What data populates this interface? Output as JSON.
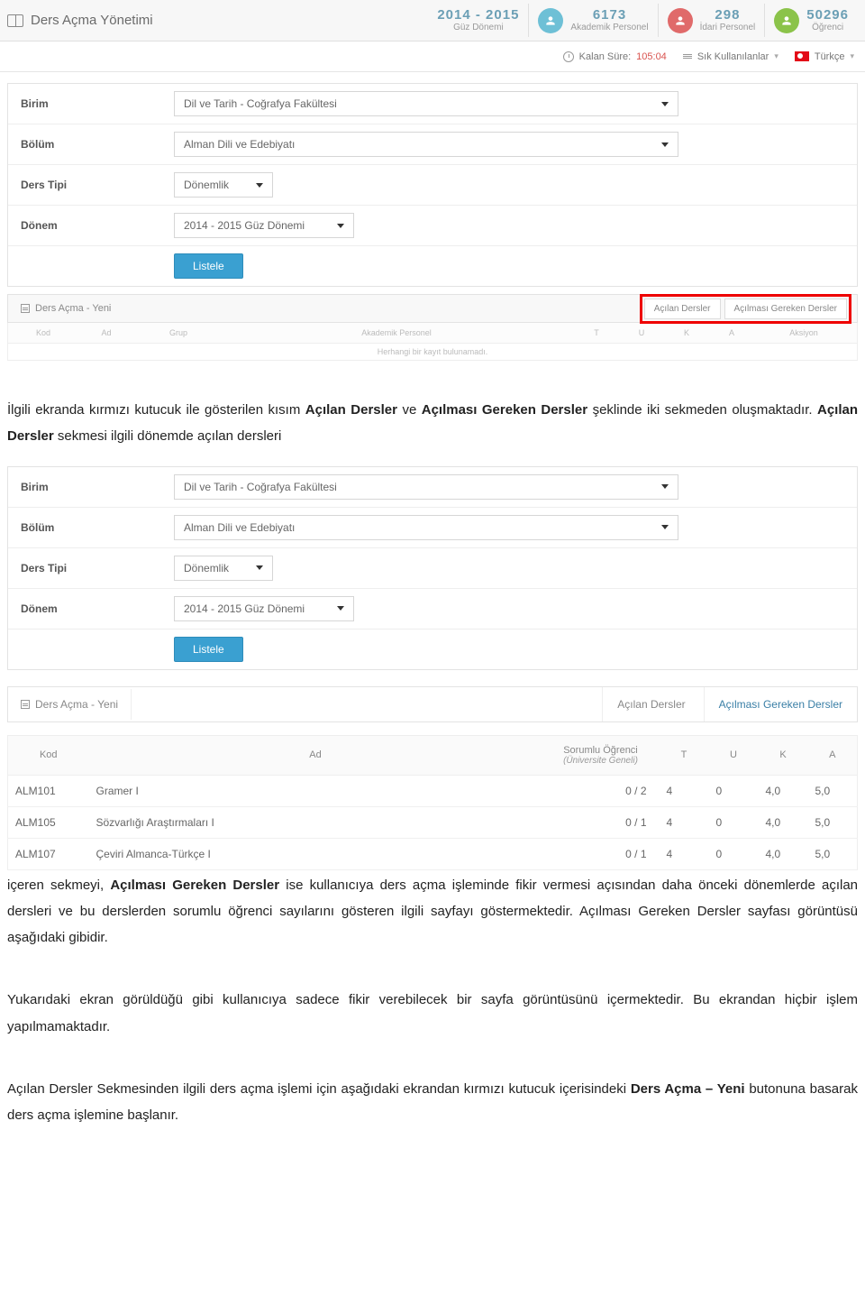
{
  "header": {
    "page_title": "Ders Açma Yönetimi",
    "stats": [
      {
        "num": "2014 - 2015",
        "label": "Güz Dönemi"
      },
      {
        "num": "6173",
        "label": "Akademik Personel"
      },
      {
        "num": "298",
        "label": "İdari Personel"
      },
      {
        "num": "50296",
        "label": "Öğrenci"
      }
    ]
  },
  "second_bar": {
    "timer_label": "Kalan Süre:",
    "timer_value": "105:04",
    "favorites": "Sık Kullanılanlar",
    "language": "Türkçe"
  },
  "filter1": {
    "birim_label": "Birim",
    "birim_value": "Dil ve Tarih - Coğrafya Fakültesi",
    "bolum_label": "Bölüm",
    "bolum_value": "Alman Dili ve Edebiyatı",
    "ders_tipi_label": "Ders Tipi",
    "ders_tipi_value": "Dönemlik",
    "donem_label": "Dönem",
    "donem_value": "2014 - 2015 Güz Dönemi",
    "listele": "Listele"
  },
  "tabstrip1": {
    "left_label": "Ders Açma - Yeni",
    "tab_a": "Açılan Dersler",
    "tab_b": "Açılması Gereken Dersler",
    "cols": {
      "kod": "Kod",
      "ad": "Ad",
      "grup": "Grup",
      "ap": "Akademik Personel",
      "t": "T",
      "u": "U",
      "k": "K",
      "a": "A",
      "aksiyon": "Aksiyon"
    },
    "no_records": "Herhangi bir kayıt bulunamadı."
  },
  "para1": {
    "pre": "İlgili ekranda kırmızı kutucuk ile gösterilen kısım ",
    "b1": "Açılan Dersler",
    "mid1": " ve ",
    "b2": "Açılması Gereken Dersler",
    "mid2": " şeklinde iki sekmeden oluşmaktadır. ",
    "b3": "Açılan Dersler",
    "post": " sekmesi ilgili dönemde açılan dersleri"
  },
  "tabstrip2": {
    "left_label": "Ders Açma - Yeni",
    "tab_a": "Açılan Dersler",
    "tab_b": "Açılması Gereken Dersler"
  },
  "table2": {
    "headers": {
      "kod": "Kod",
      "ad": "Ad",
      "so_line1": "Sorumlu Öğrenci",
      "so_line2": "(Üniversite Geneli)",
      "t": "T",
      "u": "U",
      "k": "K",
      "a": "A"
    },
    "rows": [
      {
        "kod": "ALM101",
        "ad": "Gramer I",
        "so": "0 / 2",
        "t": "4",
        "u": "0",
        "k": "4,0",
        "a": "5,0"
      },
      {
        "kod": "ALM105",
        "ad": "Sözvarlığı Araştırmaları I",
        "so": "0 / 1",
        "t": "4",
        "u": "0",
        "k": "4,0",
        "a": "5,0"
      },
      {
        "kod": "ALM107",
        "ad": "Çeviri Almanca-Türkçe I",
        "so": "0 / 1",
        "t": "4",
        "u": "0",
        "k": "4,0",
        "a": "5,0"
      }
    ]
  },
  "para2": {
    "pre": "içeren sekmeyi, ",
    "b1": "Açılması Gereken Dersler",
    "rest": " ise kullanıcıya ders açma işleminde fikir vermesi açısından daha önceki dönemlerde açılan dersleri ve bu derslerden sorumlu öğrenci sayılarını gösteren ilgili sayfayı göstermektedir. Açılması Gereken Dersler sayfası görüntüsü aşağıdaki gibidir."
  },
  "para3": "Yukarıdaki ekran görüldüğü gibi kullanıcıya sadece fikir verebilecek bir sayfa görüntüsünü içermektedir. Bu ekrandan hiçbir işlem yapılmamaktadır.",
  "para4": {
    "pre": "Açılan Dersler Sekmesinden ilgili ders açma işlemi için aşağıdaki ekrandan kırmızı kutucuk içerisindeki ",
    "b1": "Ders Açma – Yeni",
    "post": " butonuna basarak ders açma işlemine başlanır."
  }
}
